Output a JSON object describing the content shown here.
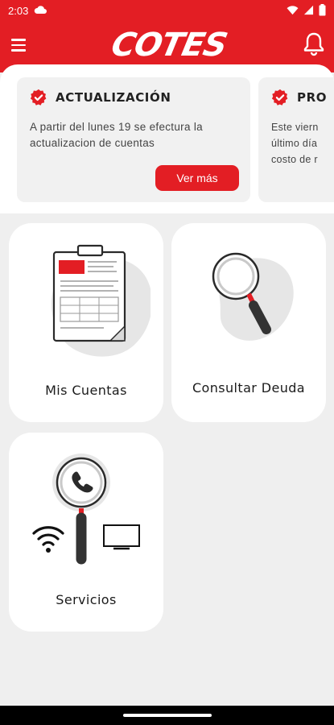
{
  "status_bar": {
    "time": "2:03"
  },
  "header": {
    "logo_text": "COTES",
    "brand_color": "#e31e24",
    "menu_icon": "hamburger-menu-icon",
    "bell_icon": "bell-icon"
  },
  "notices": [
    {
      "title": "ACTUALIZACIÓN",
      "text": "A partir del lunes 19 se efectura la actualizacion de cuentas",
      "button_label": "Ver más",
      "icon": "verified-badge-icon"
    },
    {
      "title": "PRO",
      "text_lines": [
        "Este viern",
        "último día",
        "costo de r"
      ],
      "icon": "verified-badge-icon"
    }
  ],
  "tiles": [
    {
      "label": "Mis Cuentas",
      "icon": "clipboard-document-icon"
    },
    {
      "label": "Consultar Deuda",
      "icon": "magnifying-glass-icon"
    },
    {
      "label": "Servicios",
      "icon": "services-phone-wifi-tv-icon"
    }
  ]
}
